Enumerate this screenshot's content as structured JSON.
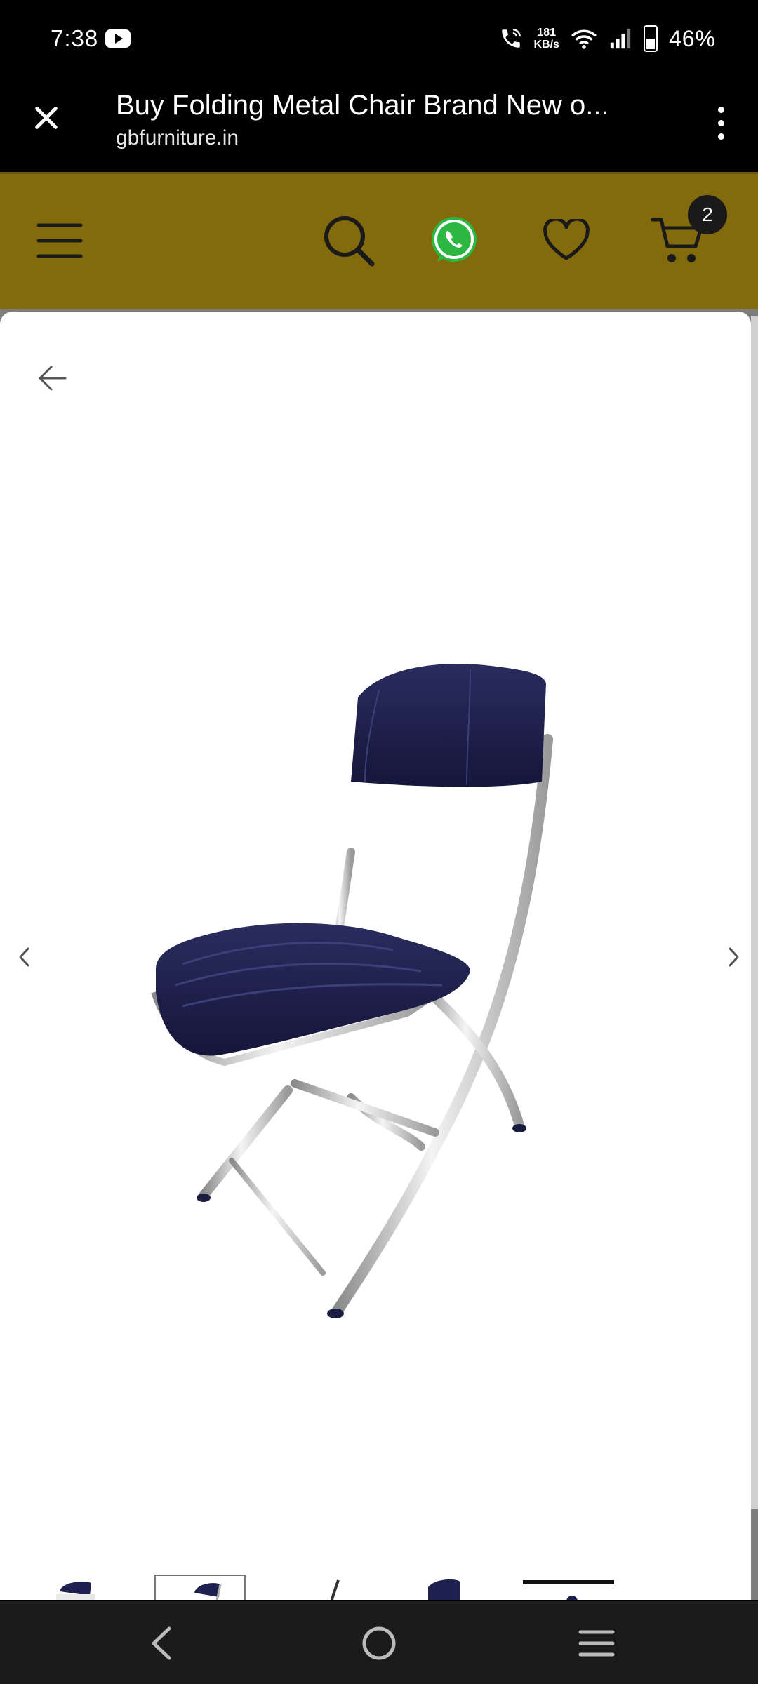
{
  "status_bar": {
    "time": "7:38",
    "speed_value": "181",
    "speed_unit": "KB/s",
    "battery": "46%",
    "icons": [
      "youtube-icon",
      "wifi-call-icon",
      "wifi-icon",
      "signal-icon",
      "battery-charging-icon"
    ]
  },
  "tab": {
    "title": "Buy Folding Metal Chair Brand New o...",
    "url": "gbfurniture.in"
  },
  "header": {
    "cart_count": "2",
    "colors": {
      "bar": "#836a0d",
      "whatsapp": "#25d366"
    },
    "icons": [
      "menu-icon",
      "search-icon",
      "whatsapp-icon",
      "heart-icon",
      "cart-icon"
    ]
  },
  "gallery": {
    "image_alt": "Folding Metal Chair",
    "thumbnail_count": 5,
    "active_thumbnail": 2
  }
}
